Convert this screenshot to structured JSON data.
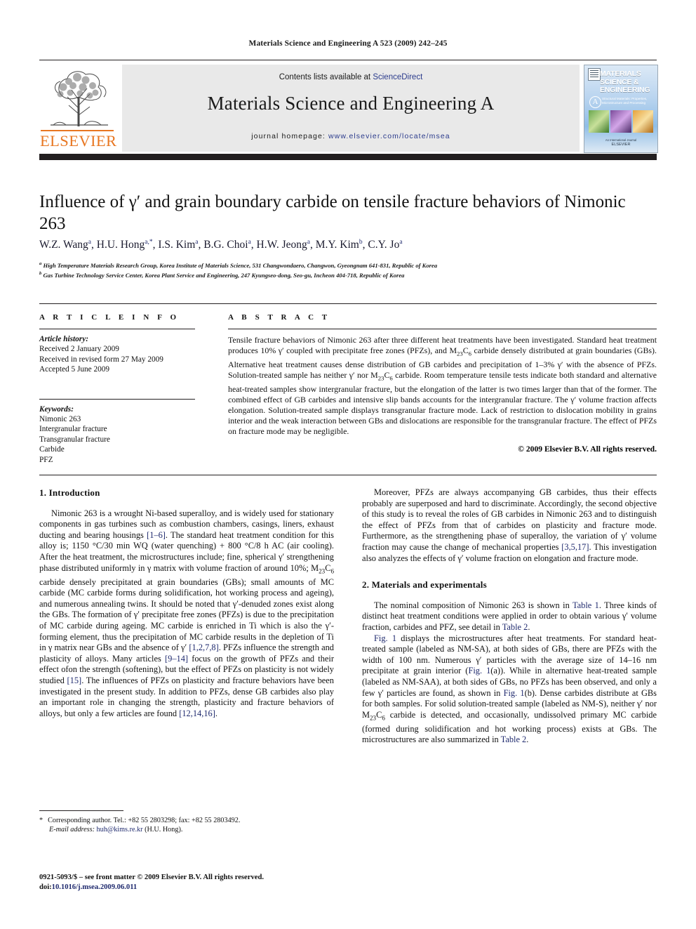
{
  "running_head": "Materials Science and Engineering A 523 (2009) 242–245",
  "masthead": {
    "contents_prefix": "Contents lists available at ",
    "sciencedirect": "ScienceDirect",
    "journal_title": "Materials Science and Engineering A",
    "homepage_prefix": "journal homepage: ",
    "homepage_url": "www.elsevier.com/locate/msea",
    "publisher": "ELSEVIER",
    "cover": {
      "title": "MATERIALS SCIENCE & ENGINEERING",
      "series_letter": "A",
      "subtitle": "Structural Materials: Properties, Microstructure and Processing",
      "footer_line1": "An International Journal",
      "footer_line2": "ELSEVIER"
    },
    "link_color": "#2b3b8c",
    "brand_color": "#E87722"
  },
  "article": {
    "title": "Influence of γ′ and grain boundary carbide on tensile fracture behaviors of Nimonic 263",
    "authors_html": "W.Z. Wang<sup>a</sup>, H.U. Hong<sup>a,</sup><sup>*</sup>, I.S. Kim<sup>a</sup>, B.G. Choi<sup>a</sup>, H.W. Jeong<sup>a</sup>, M.Y. Kim<sup>b</sup>, C.Y. Jo<sup>a</sup>",
    "affiliation_a": "High Temperature Materials Research Group, Korea Institute of Materials Science, 531 Changwondaero, Changwon, Gyeongnam 641-831, Republic of Korea",
    "affiliation_b": "Gas Turbine Technology Service Center, Korea Plant Service and Engineering, 247 Kyungseo-dong, Seo-gu, Incheon 404-718, Republic of Korea"
  },
  "info": {
    "heading": "A R T I C L E  I N F O",
    "history_label": "Article history:",
    "history": [
      "Received 2 January 2009",
      "Received in revised form 27 May 2009",
      "Accepted 5 June 2009"
    ],
    "keywords_label": "Keywords:",
    "keywords": [
      "Nimonic 263",
      "Intergranular fracture",
      "Transgranular fracture",
      "Carbide",
      "PFZ"
    ]
  },
  "abstract": {
    "heading": "A B S T R A C T",
    "body_html": "Tensile fracture behaviors of Nimonic 263 after three different heat treatments have been investigated. Standard heat treatment produces 10% γ′ coupled with precipitate free zones (PFZs), and M<sub>23</sub>C<sub>6</sub> carbide densely distributed at grain boundaries (GBs). Alternative heat treatment causes dense distribution of GB carbides and precipitation of 1–3% γ′ with the absence of PFZs. Solution-treated sample has neither γ′ nor M<sub>23</sub>C<sub>6</sub> carbide. Room temperature tensile tests indicate both standard and alternative heat-treated samples show intergranular fracture, but the elongation of the latter is two times larger than that of the former. The combined effect of GB carbides and intensive slip bands accounts for the intergranular fracture. The γ′ volume fraction affects elongation. Solution-treated sample displays transgranular fracture mode. Lack of restriction to dislocation mobility in grains interior and the weak interaction between GBs and dislocations are responsible for the transgranular fracture. The effect of PFZs on fracture mode may be negligible.",
    "copyright": "© 2009 Elsevier B.V. All rights reserved."
  },
  "sections": {
    "intro_heading": "1.  Introduction",
    "intro_p1_html": "Nimonic 263 is a wrought Ni-based superalloy, and is widely used for stationary components in gas turbines such as combustion chambers, casings, liners, exhaust ducting and bearing housings <span class=\"ref\">[1–6]</span>. The standard heat treatment condition for this alloy is; 1150 °C/30 min WQ (water quenching) + 800 °C/8 h AC (air cooling). After the heat treatment, the microstructures include; fine, spherical γ′ strengthening phase distributed uniformly in γ matrix with volume fraction of around 10%; M<sub>23</sub>C<sub>6</sub> carbide densely precipitated at grain boundaries (GBs); small amounts of MC carbide (MC carbide forms during solidification, hot working process and ageing), and numerous annealing twins. It should be noted that γ′-denuded zones exist along the GBs. The formation of γ′ precipitate free zones (PFZs) is due to the precipitation of MC carbide during ageing. MC carbide is enriched in Ti which is also the γ′-forming element, thus the precipitation of MC carbide results in the depletion of Ti in γ matrix near GBs and the absence of γ′ <span class=\"ref\">[1,2,7,8]</span>. PFZs influence the strength and plasticity of alloys. Many articles <span class=\"ref\">[9–14]</span> focus on the growth of PFZs and their effect ofon the strength (softening), but the effect of PFZs on plasticity is not widely studied <span class=\"ref\">[15]</span>. The influences of PFZs on plasticity and fracture behaviors have been investigated in the present study. In addition to PFZs, dense GB carbides also play an important role in changing the strength, plasticity and fracture behaviors of alloys, but only a few articles are found <span class=\"ref\">[12,14,16]</span>.",
    "intro_p2_html": "Moreover, PFZs are always accompanying GB carbides, thus their effects probably are superposed and hard to discriminate. Accordingly, the second objective of this study is to reveal the roles of GB carbides in Nimonic 263 and to distinguish the effect of PFZs from that of carbides on plasticity and fracture mode. Furthermore, as the strengthening phase of superalloy, the variation of γ′ volume fraction may cause the change of mechanical properties <span class=\"ref\">[3,5,17]</span>. This investigation also analyzes the effects of γ′ volume fraction on elongation and fracture mode.",
    "materials_heading": "2.  Materials and experimentals",
    "materials_p1_html": "The nominal composition of Nimonic 263 is shown in <span class=\"ref\">Table 1</span>. Three kinds of distinct heat treatment conditions were applied in order to obtain various γ′ volume fraction, carbides and PFZ, see detail in <span class=\"ref\">Table 2</span>.",
    "materials_p2_html": "<span class=\"ref\">Fig. 1</span> displays the microstructures after heat treatments. For standard heat-treated sample (labeled as NM-SA), at both sides of GBs, there are PFZs with the width of 100 nm. Numerous γ′ particles with the average size of 14–16 nm precipitate at grain interior (<span class=\"ref\">Fig. 1</span>(a)). While in alternative heat-treated sample (labeled as NM-SAA), at both sides of GBs, no PFZs has been observed, and only a few γ′ particles are found, as shown in <span class=\"ref\">Fig. 1</span>(b). Dense carbides distribute at GBs for both samples. For solid solution-treated sample (labeled as NM-S), neither γ′ nor M<sub>23</sub>C<sub>6</sub> carbide is detected, and occasionally, undissolved primary MC carbide (formed during solidification and hot working process) exists at GBs. The microstructures are also summarized in <span class=\"ref\">Table 2</span>."
  },
  "footnotes": {
    "corresponding_html": "<span class=\"ast\">*</span>Corresponding author. Tel.: +82 55 2803298; fax: +82 55 2803492.",
    "email_label": "E-mail address:",
    "email": "huh@kims.re.kr",
    "email_owner": "(H.U. Hong).",
    "issn_line": "0921-5093/$ – see front matter © 2009 Elsevier B.V. All rights reserved.",
    "doi_label": "doi:",
    "doi_value": "10.1016/j.msea.2009.06.011"
  }
}
